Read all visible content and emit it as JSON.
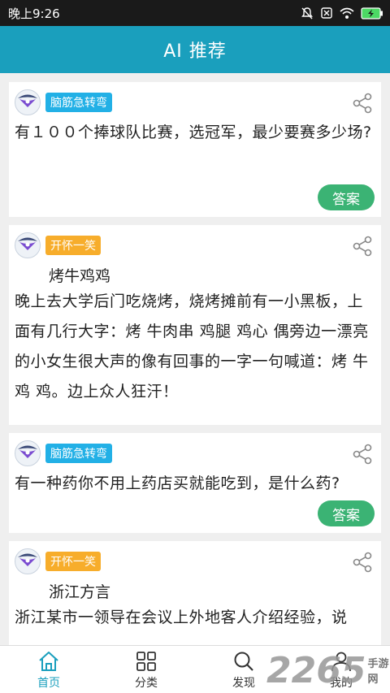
{
  "status_bar": {
    "time": "晚上9:26"
  },
  "header": {
    "title": "AI 推荐"
  },
  "cards": [
    {
      "tag": "脑筋急转弯",
      "text": "有１００个捧球队比赛，选冠军，最少要赛多少场?",
      "answer_label": "答案"
    },
    {
      "tag": "开怀一笑",
      "title": "烤牛鸡鸡",
      "text": "晚上去大学后门吃烧烤，烧烤摊前有一小黑板，上面有几行大字：烤 牛肉串 鸡腿 鸡心 偶旁边一漂亮的小女生很大声的像有回事的一字一句喊道：烤 牛 鸡 鸡。边上众人狂汗！"
    },
    {
      "tag": "脑筋急转弯",
      "text": "有一种药你不用上药店买就能吃到，是什么药?",
      "answer_label": "答案"
    },
    {
      "tag": "开怀一笑",
      "title": "浙江方言",
      "text": "浙江某市一领导在会议上外地客人介绍经验，说"
    }
  ],
  "tabs": [
    {
      "label": "首页",
      "icon": "home-icon"
    },
    {
      "label": "分类",
      "icon": "grid-icon"
    },
    {
      "label": "发现",
      "icon": "search-icon"
    },
    {
      "label": "我的",
      "icon": "user-icon"
    }
  ],
  "watermark": {
    "brand": "2265",
    "sub": "手游网"
  },
  "colors": {
    "header": "#1a9fbd",
    "tag_blue": "#22b0e6",
    "tag_orange": "#f7ad2b",
    "answer_button": "#3bb374"
  }
}
